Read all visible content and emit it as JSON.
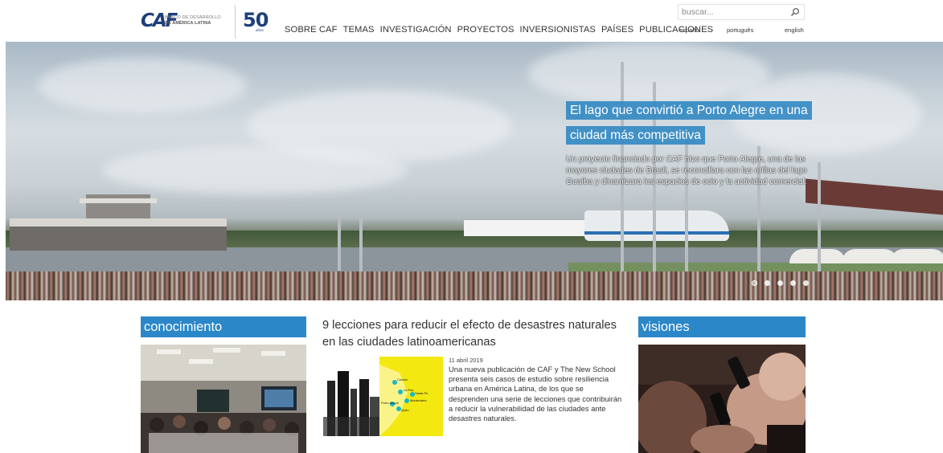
{
  "brand": {
    "logo_mark": "CAF",
    "logo_line1": "BANCO DE DESARROLLO",
    "logo_line2": "DE AMÉRICA LATINA",
    "anniversary_number": "50",
    "anniversary_label": "años",
    "primary_color": "#1d3f7a",
    "accent_color": "#2b87c8"
  },
  "nav": {
    "items": [
      "SOBRE CAF",
      "TEMAS",
      "INVESTIGACIÓN",
      "PROYECTOS",
      "INVERSIONISTAS",
      "PAÍSES",
      "PUBLICACIONES"
    ]
  },
  "search": {
    "placeholder": "buscar...",
    "icon": "search-icon"
  },
  "languages": [
    "español",
    "português",
    "english"
  ],
  "hero": {
    "title": "El lago que convirtió a Porto Alegre en una ciudad más competitiva",
    "description": "Un proyecto financiado por CAF hizo que Porto Alegre, una de las mayores ciudades de Brasil, se reconciliara con las orillas del lago Guaíba y dinamizara los espacios de ocio y la actividad comercial.",
    "slide_count": 5,
    "active_slide": 1
  },
  "sections": {
    "left_title": "conocimiento",
    "right_title": "visiones"
  },
  "featured_article": {
    "title": "9 lecciones para reducir el efecto de desastres naturales en las ciudades latinoamericanas",
    "date": "11 abril 2019",
    "summary": "Una nueva publicación de CAF y The New School presenta seis casos de estudio sobre resiliencia urbana en América Latina, de los que se desprenden una serie de lecciones que contribuirán a reducir la vulnerabilidad de las ciudades ante desastres naturales.",
    "map_labels": [
      "Cúcuta",
      "La Paz",
      "Santa Fe",
      "Montevideo",
      "Porto Alegre",
      "Quito"
    ]
  }
}
